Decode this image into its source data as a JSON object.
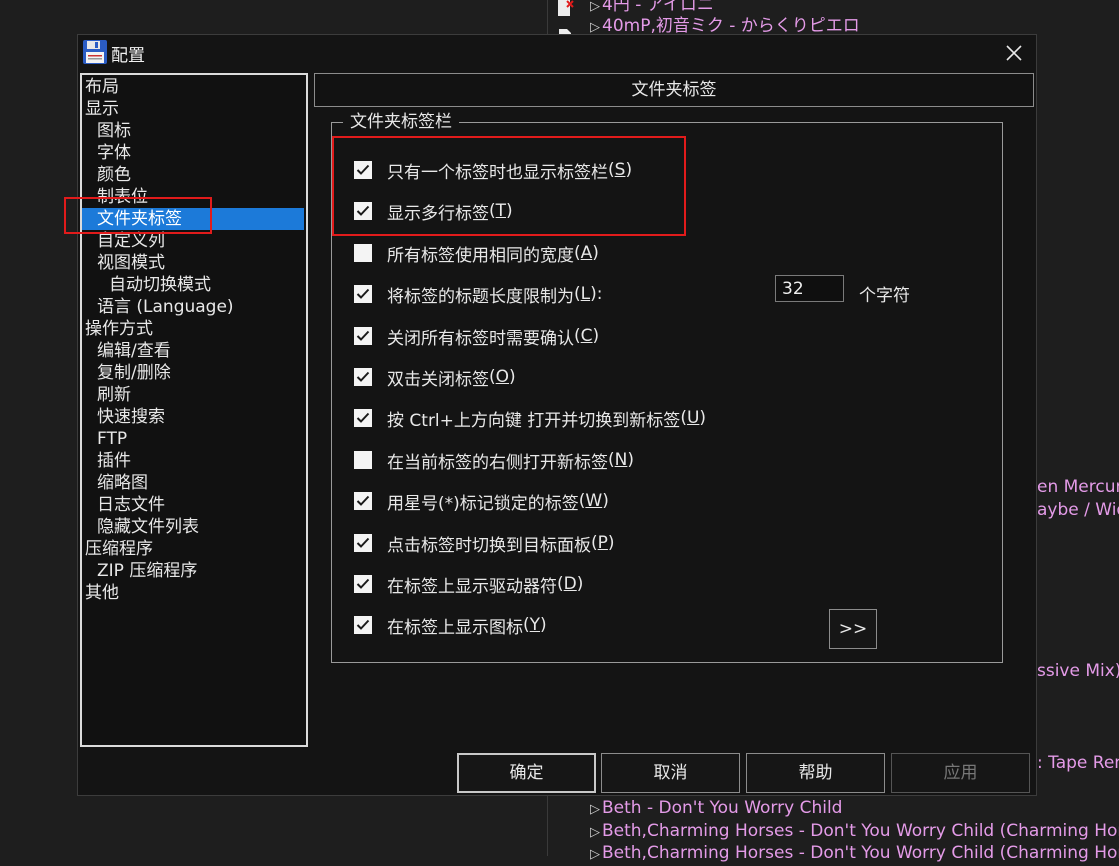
{
  "background_playlist": {
    "rows": [
      {
        "text": "4円 - アイロニ"
      },
      {
        "text": "40mP,初音ミク - からくりピエロ"
      },
      {
        "text": "Beth - Don't You Worry Child"
      },
      {
        "text": "Beth,Charming Horses - Don't You Worry Child (Charming Horses"
      },
      {
        "text": "Beth,Charming Horses - Don't You Worry Child (Charming Horses"
      }
    ],
    "fragments": [
      "en Mercurio",
      "aybe / Wid",
      "ssive Mix)",
      ": Tape Rem"
    ]
  },
  "dialog": {
    "title": "配置",
    "tree": [
      {
        "label": "布局"
      },
      {
        "label": "显示"
      },
      {
        "label": "图标"
      },
      {
        "label": "字体"
      },
      {
        "label": "颜色"
      },
      {
        "label": "制表位"
      },
      {
        "label": "文件夹标签"
      },
      {
        "label": "自定义列"
      },
      {
        "label": "视图模式"
      },
      {
        "label": "自动切换模式"
      },
      {
        "label": "语言 (Language)"
      },
      {
        "label": "操作方式"
      },
      {
        "label": "编辑/查看"
      },
      {
        "label": "复制/删除"
      },
      {
        "label": "刷新"
      },
      {
        "label": "快速搜索"
      },
      {
        "label": "FTP"
      },
      {
        "label": "插件"
      },
      {
        "label": "缩略图"
      },
      {
        "label": "日志文件"
      },
      {
        "label": "隐藏文件列表"
      },
      {
        "label": "压缩程序"
      },
      {
        "label": "ZIP 压缩程序"
      },
      {
        "label": "其他"
      }
    ],
    "selected_tree_item": "文件夹标签",
    "panel_title": "文件夹标签",
    "group_title": "文件夹标签栏",
    "options": [
      {
        "label": "只有一个标签时也显示标签栏",
        "key": "S",
        "checked": true
      },
      {
        "label": "显示多行标签",
        "key": "T",
        "checked": true
      },
      {
        "label": "所有标签使用相同的宽度",
        "key": "A",
        "checked": false
      },
      {
        "label": "将标签的标题长度限制为",
        "key": "L",
        "suffix": ":",
        "checked": true
      },
      {
        "label": "关闭所有标签时需要确认",
        "key": "C",
        "checked": true
      },
      {
        "label": "双击关闭标签",
        "key": "O",
        "checked": true
      },
      {
        "label": "按 Ctrl+上方向键 打开并切换到新标签",
        "key": "U",
        "checked": true
      },
      {
        "label": "在当前标签的右侧打开新标签",
        "key": "N",
        "checked": false
      },
      {
        "label": "用星号(*)标记锁定的标签",
        "key": "W",
        "checked": true
      },
      {
        "label": "点击标签时切换到目标面板",
        "key": "P",
        "checked": true
      },
      {
        "label": "在标签上显示驱动器符",
        "key": "D",
        "checked": true
      },
      {
        "label": "在标签上显示图标",
        "key": "Y",
        "checked": true
      }
    ],
    "length_limit": {
      "value": "32",
      "unit": "个字符"
    },
    "more_button": ">>",
    "buttons": {
      "ok": "确定",
      "cancel": "取消",
      "help": "帮助",
      "apply": "应用"
    }
  },
  "colors": {
    "selection": "#1c7ad9",
    "annotation_red": "#e11b1b",
    "playlist_text": "#e49be8"
  },
  "icons": {
    "app": "floppy-disk-icon",
    "close": "close-icon",
    "check": "checkmark-icon",
    "row_marker": "play-triangle-icon"
  }
}
